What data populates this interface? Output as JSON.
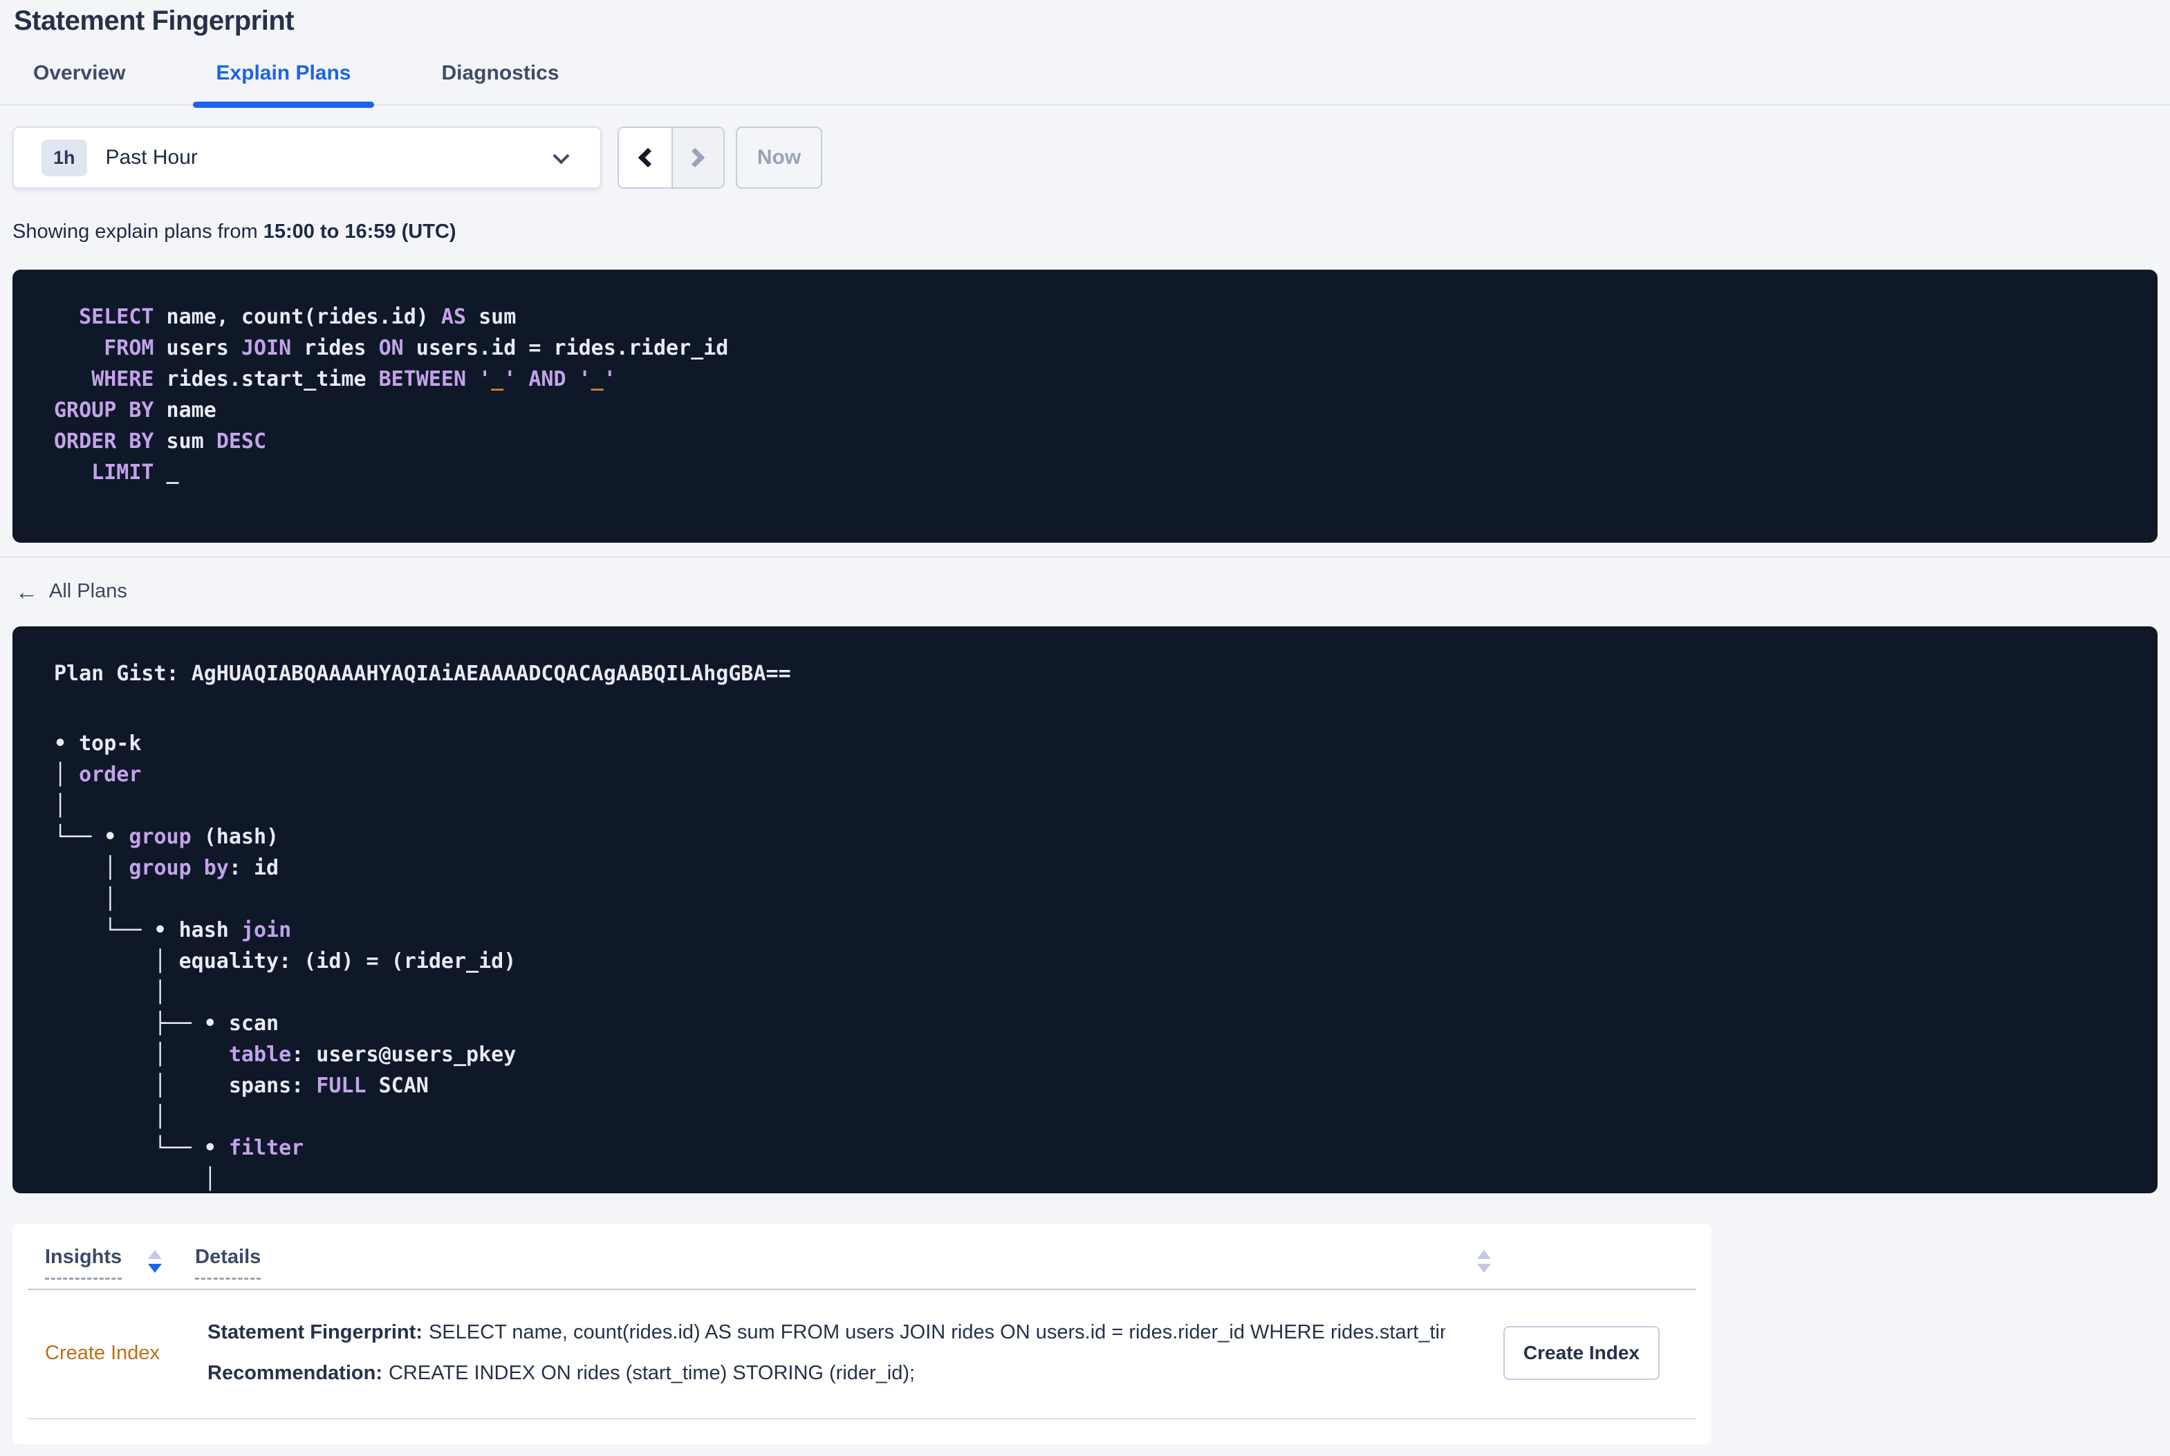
{
  "page": {
    "title": "Statement Fingerprint"
  },
  "tabs": {
    "overview": "Overview",
    "explain_plans": "Explain Plans",
    "diagnostics": "Diagnostics"
  },
  "time_controls": {
    "badge": "1h",
    "selected": "Past Hour",
    "now": "Now"
  },
  "summary": {
    "prefix": "Showing explain plans from ",
    "range": "15:00 to 16:59 (UTC)"
  },
  "icons": {
    "back_arrow": "←"
  },
  "sql_block": {
    "lines": [
      [
        {
          "c": "p",
          "t": "  "
        },
        {
          "c": "k",
          "t": "SELECT"
        },
        {
          "c": "p",
          "t": " name, count(rides.id) "
        },
        {
          "c": "k",
          "t": "AS"
        },
        {
          "c": "p",
          "t": " sum"
        }
      ],
      [
        {
          "c": "p",
          "t": "    "
        },
        {
          "c": "k",
          "t": "FROM"
        },
        {
          "c": "p",
          "t": " users "
        },
        {
          "c": "k",
          "t": "JOIN"
        },
        {
          "c": "p",
          "t": " rides "
        },
        {
          "c": "k",
          "t": "ON"
        },
        {
          "c": "p",
          "t": " users.id = rides.rider_id"
        }
      ],
      [
        {
          "c": "p",
          "t": "   "
        },
        {
          "c": "k",
          "t": "WHERE"
        },
        {
          "c": "p",
          "t": " rides.start_time "
        },
        {
          "c": "k",
          "t": "BETWEEN"
        },
        {
          "c": "p",
          "t": " "
        },
        {
          "c": "q",
          "t": "'"
        },
        {
          "c": "o",
          "t": "_"
        },
        {
          "c": "q",
          "t": "'"
        },
        {
          "c": "p",
          "t": " "
        },
        {
          "c": "k",
          "t": "AND"
        },
        {
          "c": "p",
          "t": " "
        },
        {
          "c": "q",
          "t": "'"
        },
        {
          "c": "o",
          "t": "_"
        },
        {
          "c": "q",
          "t": "'"
        }
      ],
      [
        {
          "c": "k",
          "t": "GROUP BY"
        },
        {
          "c": "p",
          "t": " name"
        }
      ],
      [
        {
          "c": "k",
          "t": "ORDER BY"
        },
        {
          "c": "p",
          "t": " sum "
        },
        {
          "c": "k",
          "t": "DESC"
        }
      ],
      [
        {
          "c": "p",
          "t": "   "
        },
        {
          "c": "k",
          "t": "LIMIT"
        },
        {
          "c": "p",
          "t": " _"
        }
      ]
    ]
  },
  "nav": {
    "all_plans": "All Plans"
  },
  "plan": {
    "gist_label": "Plan Gist: ",
    "gist": "AgHUAQIABQAAAAHYAQIAiAEAAAADCQACAgAABQILAhgGBA==",
    "tree": [
      [
        {
          "c": "p",
          "t": "• top-k"
        }
      ],
      [
        {
          "c": "p",
          "t": "│ "
        },
        {
          "c": "k",
          "t": "order"
        }
      ],
      [
        {
          "c": "p",
          "t": "│"
        }
      ],
      [
        {
          "c": "p",
          "t": "└── • "
        },
        {
          "c": "k",
          "t": "group"
        },
        {
          "c": "p",
          "t": " (hash)"
        }
      ],
      [
        {
          "c": "p",
          "t": "    │ "
        },
        {
          "c": "k",
          "t": "group by"
        },
        {
          "c": "p",
          "t": ": id"
        }
      ],
      [
        {
          "c": "p",
          "t": "    │"
        }
      ],
      [
        {
          "c": "p",
          "t": "    └── • hash "
        },
        {
          "c": "k",
          "t": "join"
        }
      ],
      [
        {
          "c": "p",
          "t": "        │ equality: (id) = (rider_id)"
        }
      ],
      [
        {
          "c": "p",
          "t": "        │"
        }
      ],
      [
        {
          "c": "p",
          "t": "        ├── • scan"
        }
      ],
      [
        {
          "c": "p",
          "t": "        │     "
        },
        {
          "c": "k",
          "t": "table"
        },
        {
          "c": "p",
          "t": ": users@users_pkey"
        }
      ],
      [
        {
          "c": "p",
          "t": "        │     spans: "
        },
        {
          "c": "k",
          "t": "FULL"
        },
        {
          "c": "p",
          "t": " SCAN"
        }
      ],
      [
        {
          "c": "p",
          "t": "        │"
        }
      ],
      [
        {
          "c": "p",
          "t": "        └── • "
        },
        {
          "c": "k",
          "t": "filter"
        }
      ],
      [
        {
          "c": "p",
          "t": "            │"
        }
      ]
    ]
  },
  "insights": {
    "col_insights": "Insights",
    "col_details": "Details",
    "row": {
      "insight": "Create Index",
      "fingerprint_label": "Statement Fingerprint:",
      "fingerprint_text": "SELECT name, count(rides.id) AS sum FROM users JOIN rides ON users.id = rides.rider_id WHERE rides.start_time BETWEEN '_…",
      "recommendation_label": "Recommendation:",
      "recommendation_text": "CREATE INDEX ON rides (start_time) STORING (rider_id);",
      "action": "Create Index"
    }
  },
  "colors": {
    "accent_blue": "#1d63e8",
    "keyword_purple": "#c4a3ea",
    "code_background": "#0f1828",
    "code_text": "#e9eaf3",
    "param_orange": "#d9822f",
    "insight_orange": "#c06e14",
    "page_background": "#f4f5f9"
  }
}
